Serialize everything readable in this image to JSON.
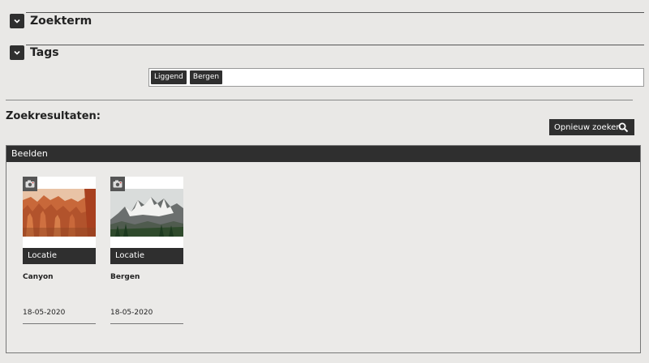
{
  "filters": {
    "search_term": {
      "label": "Zoekterm"
    },
    "tags": {
      "label": "Tags",
      "values": [
        "Liggend",
        "Bergen"
      ]
    }
  },
  "results": {
    "heading": "Zoekresultaten:",
    "search_again_label": "Opnieuw zoeken"
  },
  "panel": {
    "title": "Beelden",
    "items": [
      {
        "category": "Locatie",
        "name": "Canyon",
        "date": "18-05-2020"
      },
      {
        "category": "Locatie",
        "name": "Bergen",
        "date": "18-05-2020"
      }
    ]
  },
  "colors": {
    "dark": "#2f2f2f",
    "background": "#e9e8e6"
  }
}
